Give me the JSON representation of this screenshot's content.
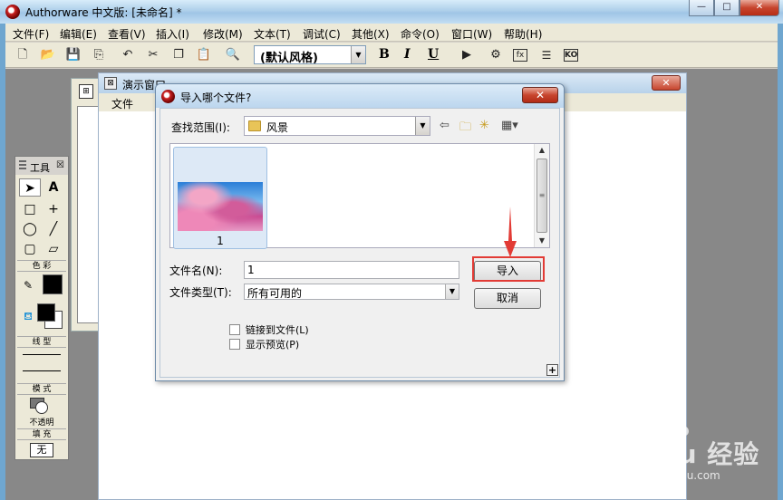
{
  "app": {
    "title": "Authorware 中文版: [未命名] *",
    "min_glyph": "—",
    "max_glyph": "□",
    "close_glyph": "✕"
  },
  "menubar": {
    "items": [
      "文件(F)",
      "编辑(E)",
      "查看(V)",
      "插入(I)",
      "修改(M)",
      "文本(T)",
      "调试(C)",
      "其他(X)",
      "命令(O)",
      "窗口(W)",
      "帮助(H)"
    ]
  },
  "toolbar": {
    "style_value": "(默认风格)",
    "bold": "B",
    "italic": "I",
    "underline": "U",
    "icons": [
      "new-icon",
      "open-icon",
      "save-all-icon",
      "import-icon",
      "undo-icon",
      "cut-icon",
      "copy-icon",
      "paste-icon",
      "find-icon",
      "run-icon",
      "control-panel-icon",
      "functions-icon",
      "variables-icon",
      "knowledge-objects-icon"
    ],
    "glyphs": {
      "fx": "fx",
      "ko": "KO"
    }
  },
  "present_window": {
    "title": "演示窗口",
    "menu_file": "文件",
    "close_glyph": "✕"
  },
  "tools_panel": {
    "title": "工具",
    "close_glyph": "☒",
    "section_color": "色 彩",
    "section_line": "线 型",
    "section_mode": "模 式",
    "mode_value": "不透明",
    "section_fill": "填 充",
    "fill_value": "无"
  },
  "dialog": {
    "title": "导入哪个文件?",
    "close_glyph": "✕",
    "lookin_label": "查找范围(I):",
    "lookin_value": "风景",
    "files": [
      {
        "name": "1"
      }
    ],
    "filename_label": "文件名(N):",
    "filename_value": "1",
    "filetype_label": "文件类型(T):",
    "filetype_value": "所有可用的",
    "import_button": "导入",
    "cancel_button": "取消",
    "link_checkbox": "链接到文件(L)",
    "preview_checkbox": "显示预览(P)",
    "expand_glyph": "+"
  },
  "watermark": {
    "brand": "Bai du 经验",
    "sub": "jingyan.baidu.com"
  },
  "colors": {
    "highlight": "#e23b35",
    "arrow": "#e23b35"
  }
}
